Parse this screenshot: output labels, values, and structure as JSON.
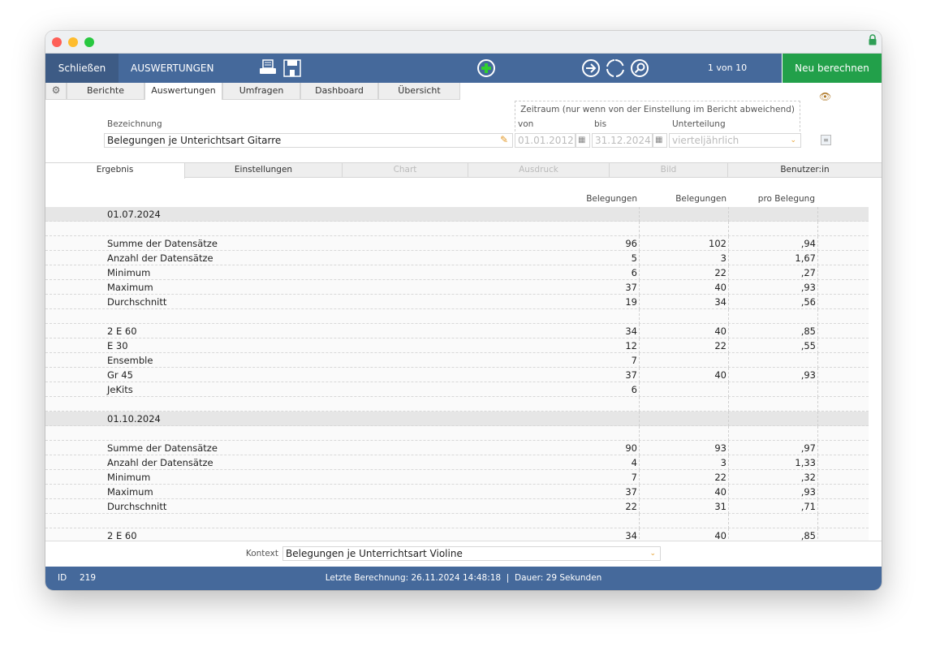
{
  "window": {
    "colors": {
      "header": "#45699b",
      "recalc": "#22a04a"
    }
  },
  "header": {
    "close_label": "Schließen",
    "title": "AUSWERTUNGEN",
    "record_position": "1 von 10",
    "recalc_label": "Neu berechnen",
    "icons": [
      "printer-icon",
      "save-icon",
      "add-icon",
      "forward-icon",
      "refresh-icon",
      "search-icon",
      "lock-icon"
    ]
  },
  "tabs": [
    {
      "label": "Berichte"
    },
    {
      "label": "Auswertungen",
      "active": true
    },
    {
      "label": "Umfragen"
    },
    {
      "label": "Dashboard"
    },
    {
      "label": "Übersicht"
    }
  ],
  "form": {
    "name_label": "Bezeichnung",
    "name_value": "Belegungen je Unterichtsart Gitarre",
    "period_label": "Zeitraum (nur wenn von der Einstellung im Bericht abweichend)",
    "from_label": "von",
    "from_value": "01.01.2012",
    "to_label": "bis",
    "to_value": "31.12.2024",
    "division_label": "Unterteilung",
    "division_value": "vierteljährlich"
  },
  "subtabs": [
    {
      "label": "Ergebnis",
      "active": true
    },
    {
      "label": "Einstellungen"
    },
    {
      "label": "Chart",
      "disabled": true
    },
    {
      "label": "Ausdruck",
      "disabled": true
    },
    {
      "label": "Bild",
      "disabled": true
    },
    {
      "label": "Benutzer:in"
    }
  ],
  "columns": [
    "Belegungen",
    "Belegungen",
    "pro Belegung"
  ],
  "rows": [
    {
      "type": "group",
      "name": "01.07.2024"
    },
    {
      "type": "blank"
    },
    {
      "name": "Summe der Datensätze",
      "values": [
        "96",
        "102",
        ",94"
      ]
    },
    {
      "name": "Anzahl der Datensätze",
      "values": [
        "5",
        "3",
        "1,67"
      ]
    },
    {
      "name": "Minimum",
      "values": [
        "6",
        "22",
        ",27"
      ]
    },
    {
      "name": "Maximum",
      "values": [
        "37",
        "40",
        ",93"
      ]
    },
    {
      "name": "Durchschnitt",
      "values": [
        "19",
        "34",
        ",56"
      ]
    },
    {
      "type": "blank"
    },
    {
      "name": "2 E 60",
      "values": [
        "34",
        "40",
        ",85"
      ]
    },
    {
      "name": "E 30",
      "values": [
        "12",
        "22",
        ",55"
      ]
    },
    {
      "name": "Ensemble",
      "values": [
        "7",
        "",
        ""
      ]
    },
    {
      "name": "Gr 45",
      "values": [
        "37",
        "40",
        ",93"
      ]
    },
    {
      "name": "JeKits",
      "values": [
        "6",
        "",
        ""
      ]
    },
    {
      "type": "blank"
    },
    {
      "type": "group",
      "name": "01.10.2024"
    },
    {
      "type": "blank"
    },
    {
      "name": "Summe der Datensätze",
      "values": [
        "90",
        "93",
        ",97"
      ]
    },
    {
      "name": "Anzahl der Datensätze",
      "values": [
        "4",
        "3",
        "1,33"
      ]
    },
    {
      "name": "Minimum",
      "values": [
        "7",
        "22",
        ",32"
      ]
    },
    {
      "name": "Maximum",
      "values": [
        "37",
        "40",
        ",93"
      ]
    },
    {
      "name": "Durchschnitt",
      "values": [
        "22",
        "31",
        ",71"
      ]
    },
    {
      "type": "blank"
    },
    {
      "name": "2 E 60",
      "values": [
        "34",
        "40",
        ",85"
      ]
    }
  ],
  "context": {
    "label": "Kontext",
    "value": "Belegungen je Unterrichtsart Violine"
  },
  "footer": {
    "id_label": "ID",
    "id_value": "219",
    "status": "Letzte Berechnung: 26.11.2024 14:48:18  |  Dauer: 29 Sekunden"
  }
}
